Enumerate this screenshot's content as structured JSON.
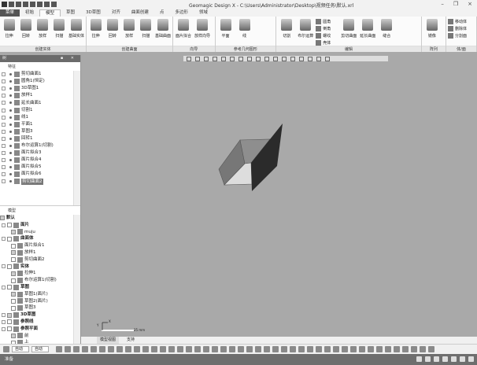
{
  "window": {
    "title": "Geomagic Design X - C:\\Users\\Administrator\\Desktop\\视频任务\\默认.xrl",
    "minimize": "–",
    "restore": "❐",
    "close": "×"
  },
  "tabs": [
    "菜单",
    "初始",
    "模型",
    "草图",
    "3D草图",
    "对齐",
    "曲面创建",
    "点",
    "多边形",
    "领域"
  ],
  "active_tab": "模型",
  "ribbon": {
    "groups": [
      {
        "label": "创建实体",
        "buttons": [
          "拉伸",
          "回转",
          "放样",
          "扫描",
          "基础实体"
        ]
      },
      {
        "label": "创建曲面",
        "buttons": [
          "拉伸",
          "回转",
          "放样",
          "扫描",
          "基础曲面"
        ]
      },
      {
        "label": "向导",
        "buttons": [
          "面片拟合",
          "放样向导"
        ]
      },
      {
        "label": "参考几何图形",
        "buttons": [
          "平面",
          "线"
        ]
      },
      {
        "label": "编辑",
        "buttons": [
          "切割",
          "布尔运算"
        ],
        "small": [
          "圆角",
          "倒角",
          "螺纹",
          "壳体",
          "赋厚曲面",
          "押出成形"
        ],
        "buttons2": [
          "剪切曲面",
          "延长曲面",
          "缝合"
        ]
      },
      {
        "label": "阵列",
        "buttons": [
          "镜像"
        ]
      },
      {
        "label": "体/面",
        "small": [
          "移动体",
          "删除体",
          "分割面"
        ]
      }
    ]
  },
  "panel": {
    "title": "树",
    "section_features": "特征",
    "section_model": "模型",
    "features": [
      "剪切曲面1",
      "圆角1(恒定)",
      "3D草图1",
      "放样1",
      "延长曲面1",
      "切割1",
      "线1",
      "平面1",
      "草图3",
      "回转1",
      "布尔运算1(切割)",
      "面片拟合3",
      "面片拟合4",
      "面片拟合5",
      "面片拟合6",
      "剪切曲面2"
    ],
    "model": {
      "root": "默认",
      "items": [
        {
          "label": "面片",
          "level": 0,
          "bold": true
        },
        {
          "label": "muju",
          "level": 1
        },
        {
          "label": "曲面体",
          "level": 0,
          "bold": true
        },
        {
          "label": "面片拟合1",
          "level": 1
        },
        {
          "label": "放样1",
          "level": 1
        },
        {
          "label": "剪切曲面2",
          "level": 1
        },
        {
          "label": "实体",
          "level": 0,
          "bold": true
        },
        {
          "label": "拉伸1",
          "level": 1
        },
        {
          "label": "布尔运算1(切割)",
          "level": 1
        },
        {
          "label": "草图",
          "level": 0,
          "bold": true
        },
        {
          "label": "草图1(面片)",
          "level": 1
        },
        {
          "label": "草图2(面片)",
          "level": 1
        },
        {
          "label": "草图3",
          "level": 1
        },
        {
          "label": "3D草图",
          "level": 0,
          "bold": true
        },
        {
          "label": "参照线",
          "level": 0,
          "bold": true
        },
        {
          "label": "参照平面",
          "level": 0,
          "bold": true
        },
        {
          "label": "前",
          "level": 1
        },
        {
          "label": "上",
          "level": 1
        }
      ]
    }
  },
  "viewport": {
    "axis_x": "X",
    "axis_y": "Y",
    "scale": "25 mm"
  },
  "bottom_tabs": [
    "模型视图",
    "支持"
  ],
  "bottom_toolbar": {
    "select1": "自动",
    "select2": "自动"
  },
  "status": {
    "text": "准备"
  },
  "colors": {
    "panel_header": "#6b6b6b",
    "viewport": "#a9a9a9",
    "status": "#6e6e6e"
  }
}
